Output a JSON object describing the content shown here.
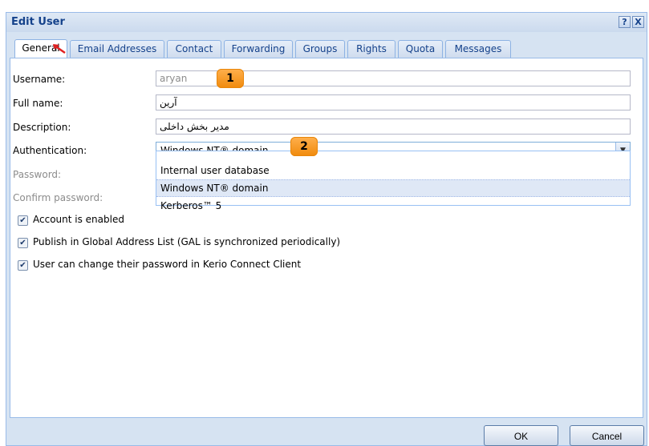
{
  "dialog": {
    "title": "Edit User",
    "help_icon": "?",
    "close_icon": "X"
  },
  "tabs": [
    {
      "label": "General"
    },
    {
      "label": "Email Addresses"
    },
    {
      "label": "Contact"
    },
    {
      "label": "Forwarding"
    },
    {
      "label": "Groups"
    },
    {
      "label": "Rights"
    },
    {
      "label": "Quota"
    },
    {
      "label": "Messages"
    }
  ],
  "form": {
    "username_label": "Username:",
    "username_value": "aryan",
    "fullname_label": "Full name:",
    "fullname_value": "آرین",
    "description_label": "Description:",
    "description_value": "مدیر بخش داخلی",
    "auth_label": "Authentication:",
    "auth_value": "Windows NT® domain",
    "password_label": "Password:",
    "confirm_label": "Confirm password:"
  },
  "auth_options": [
    "Internal user database",
    "Windows NT® domain",
    "Kerberos™ 5"
  ],
  "checkboxes": [
    {
      "label": "Account is enabled",
      "checked": true
    },
    {
      "label": "Publish in Global Address List (GAL is synchronized periodically)",
      "checked": true
    },
    {
      "label": "User can change their password in Kerio Connect Client",
      "checked": true
    }
  ],
  "badges": [
    "1",
    "2"
  ],
  "buttons": {
    "ok": "OK",
    "cancel": "Cancel"
  },
  "colors": {
    "accent": "#15428b",
    "badge": "#f59a1f",
    "arrow": "#e02020"
  },
  "icons": {
    "dropdown": "chevron-down-icon",
    "check": "checkmark-icon"
  }
}
